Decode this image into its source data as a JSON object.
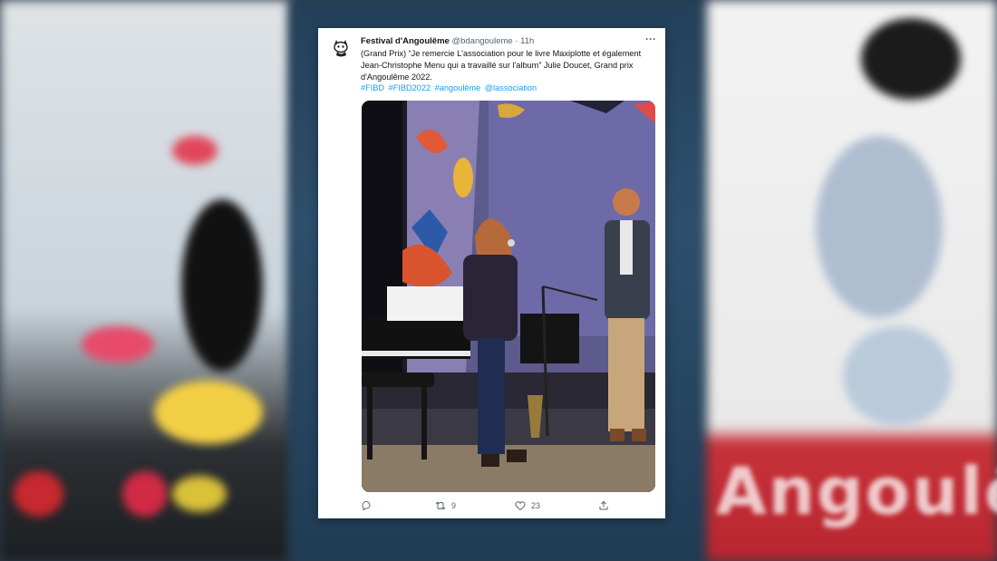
{
  "tweet": {
    "account_name": "Festival d'Angoulême",
    "handle": "@bdangouleme",
    "separator": "·",
    "time": "11h",
    "more_label": "···",
    "text": "(Grand Prix) “Je remercie L'association pour le livre Maxiplotte et également Jean-Christophe Menu qui a travaillé sur l'album” Julie Doucet, Grand prix d'Angoulême 2022.",
    "hashtags": [
      "#FIBD",
      "#FIBD2022",
      "#angoulême",
      "@lassociation"
    ],
    "actions": {
      "reply_count": "",
      "retweet_count": "9",
      "like_count": "23"
    },
    "icons": [
      "reply-icon",
      "retweet-icon",
      "like-icon",
      "share-icon",
      "more-icon"
    ]
  },
  "background": {
    "word": "Angoulê",
    "colors": {
      "accent_red": "#c8323a",
      "link_blue": "#1d9bf0"
    }
  }
}
